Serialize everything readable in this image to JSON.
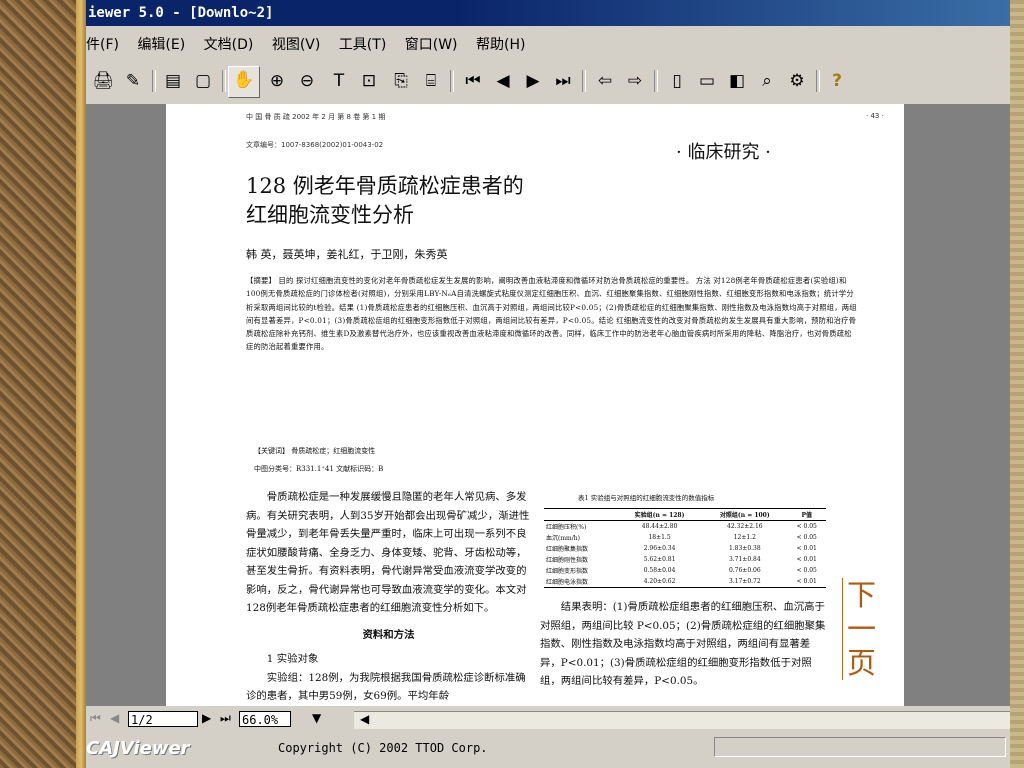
{
  "window": {
    "title": "iewer 5.0 - [Downlo~2]"
  },
  "menu": [
    "件(F)",
    "编辑(E)",
    "文档(D)",
    "视图(V)",
    "工具(T)",
    "窗口(W)",
    "帮助(H)"
  ],
  "article": {
    "journal_header": "中 国 骨 质 疏 2002 年 2 月 第 8 卷 第 1 期",
    "page_no": "· 43 ·",
    "article_id": "文章编号：1007-8368(2002)01-0043-02",
    "section": "· 临床研究 ·",
    "title_line1": "128 例老年骨质疏松症患者的",
    "title_line2": "红细胞流变性分析",
    "authors": "韩  英，聂英坤，姜礼红，于卫刚，朱秀英",
    "abstract": "【摘要】 目的  探讨红细胞流变性的变化对老年骨质疏松症发生发展的影响，阐明改善血液粘滞度和微循环对防治骨质疏松症的重要性。 方法  对128例老年骨质疏松症患者(实验组)和100例无骨质疏松症的门诊体检者(对照组)，分别采用LBY-N₆A自清洗螺旋式粘度仪测定红细胞压积、血沉、红细胞聚集指数、红细胞刚性指数、红细胞变形指数和电泳指数；统计学分析采取两组间比较的t检验。结果 (1)骨质疏松症患者的红细胞压积、血沉高于对照组，两组间比较P<0.05；(2)骨质疏松症的红细胞聚集指数、刚性指数及电泳指数均高于对照组，两组间有显著差异，P<0.01；(3)骨质疏松症组的红细胞变形指数低于对照组，两组间比较有差异，P<0.05。结论  红细胞流变性的改变对骨质疏松的发生发展具有重大影响，预防和治疗骨质疏松症除补充钙剂、维生素D及激素替代治疗外，也应该重视改善血液粘滞度和微循环的改善。同样，临床工作中的防治老年心脑血管疾病时所采用的降粘、降脂治疗，也对骨质疏松症的防治起着重要作用。",
    "keywords": "【关键词】  骨质疏松症；红细胞流变性",
    "classification": "中图分类号：R331.1⁺41       文献标识码：B",
    "body_left_p1": "骨质疏松症是一种发展缓慢且隐匿的老年人常见病、多发病。有关研究表明，人到35岁开始都会出现骨矿减少，渐进性骨量减少，到老年骨丢失量严重时，临床上可出现一系列不良症状如腰酸背痛、全身乏力、身体变矮、驼背、牙齿松动等，甚至发生骨折。有资料表明，骨代谢异常受血液流变学改变的影响，反之，骨代谢异常也可导致血液流变学的变化。本文对128例老年骨质疏松症患者的红细胞流变性分析如下。",
    "methods_heading": "资料和方法",
    "subheading": "1  实验对象",
    "body_left_p2": "实验组：128例，为我院根据我国骨质疏松症诊断标准确诊的患者，其中男59例，女69例。平均年龄",
    "table": {
      "title": "表1  实验组与对照组的红细胞流变性的数值指标",
      "headers": [
        "",
        "实验组(n = 128)",
        "对照组(n = 100)",
        "P值"
      ],
      "rows": [
        [
          "红细胞压积(%)",
          "48.44±2.80",
          "42.32±2.16",
          "< 0.05"
        ],
        [
          "血沉(mm/h)",
          "18±1.5",
          "12±1.2",
          "< 0.05"
        ],
        [
          "红细胞聚集指数",
          "2.96±0.34",
          "1.83±0.38",
          "< 0.01"
        ],
        [
          "红细胞刚性指数",
          "5.62±0.81",
          "3.71±0.84",
          "< 0.01"
        ],
        [
          "红细胞变形指数",
          "0.58±0.04",
          "0.76±0.06",
          "< 0.05"
        ],
        [
          "红细胞电泳指数",
          "4.20±0.62",
          "3.17±0.72",
          "< 0.01"
        ]
      ]
    },
    "results": "结果表明：(1)骨质疏松症组患者的红细胞压积、血沉高于对照组，两组间比较 P<0.05；(2)骨质疏松症组的红细胞聚集指数、刚性指数及电泳指数均高于对照组，两组间有显著差异，P<0.01；(3)骨质疏松症组的红细胞变形指数低于对照组，两组间比较有差异，P<0.05。"
  },
  "next_page": "下一页",
  "status": {
    "page": "1/2",
    "zoom": "66.0%"
  },
  "footer": {
    "brand": "CAJViewer",
    "copyright": "Copyright (C) 2002 TTOD Corp."
  }
}
